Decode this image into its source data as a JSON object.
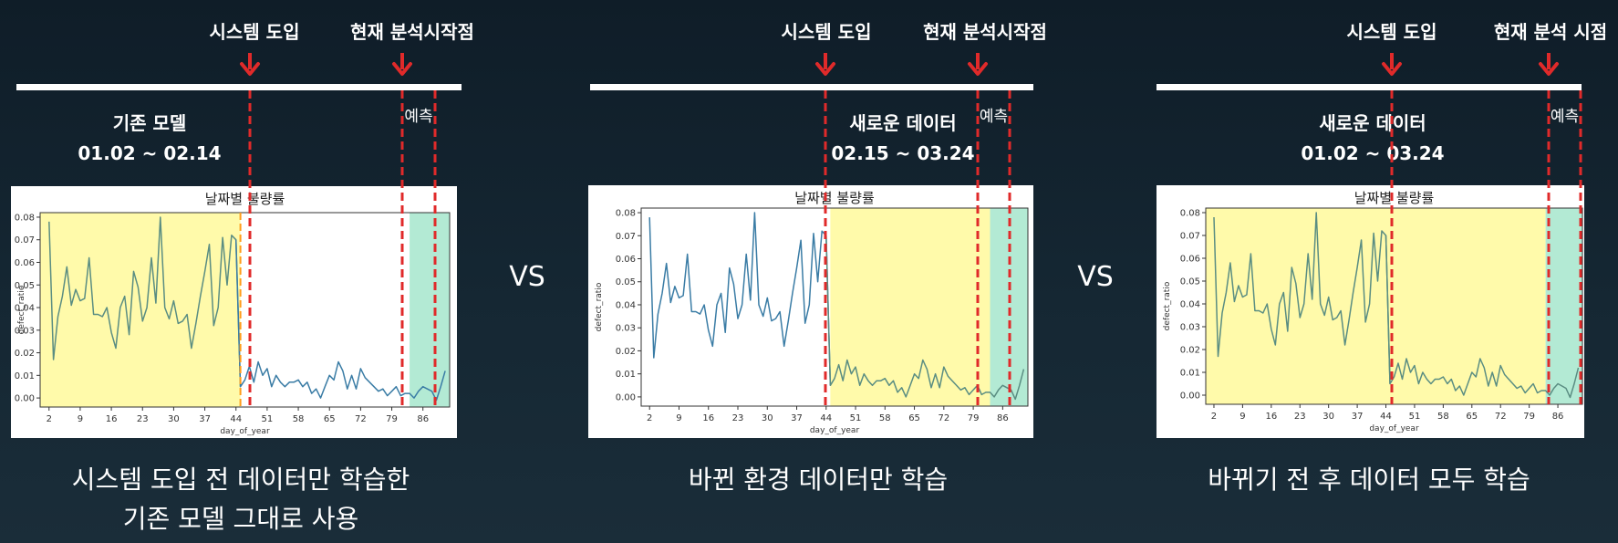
{
  "labels": {
    "intro": "시스템 도입",
    "now_start": "현재 분석시작점",
    "now_point": "현재 분석 시점",
    "predict": "예측",
    "vs": "VS",
    "plot_title": "날짜별 불량률",
    "xlabel": "day_of_year",
    "ylabel": "defect_ratio"
  },
  "panels": [
    {
      "model": "기존 모델",
      "range": "01.02 ~ 02.14",
      "caption_lines": [
        "시스템 도입 전 데이터만 학습한",
        "기존 모델 그대로 사용"
      ],
      "highlight": "before",
      "now_label": "now_start"
    },
    {
      "model": "새로운 데이터",
      "range": "02.15 ~ 03.24",
      "caption_lines": [
        "바뀐 환경 데이터만 학습"
      ],
      "highlight": "after",
      "now_label": "now_start"
    },
    {
      "model": "새로운 데이터",
      "range": "01.02 ~ 03.24",
      "caption_lines": [
        "바뀌기 전 후 데이터 모두 학습"
      ],
      "highlight": "all",
      "now_label": "now_point"
    }
  ],
  "colors": {
    "train_highlight": "#fffaaa",
    "predict_highlight": "#b3ead4",
    "line_before": "#5a8d82",
    "line_after": "#3a7ca5",
    "marker_red": "#e02a2a",
    "marker_orange": "#ff9c1a"
  },
  "chart_data": {
    "type": "line",
    "title": "날짜별 불량률",
    "xlabel": "day_of_year",
    "ylabel": "defect_ratio",
    "xlim": [
      0,
      92
    ],
    "ylim": [
      -0.004,
      0.082
    ],
    "xticks": [
      2,
      9,
      16,
      23,
      30,
      37,
      44,
      51,
      58,
      65,
      72,
      79,
      86
    ],
    "yticks": [
      0.0,
      0.01,
      0.02,
      0.03,
      0.04,
      0.05,
      0.06,
      0.07,
      0.08
    ],
    "ytick_labels": [
      "0.00",
      "0.01",
      "0.02",
      "0.03",
      "0.04",
      "0.05",
      "0.06",
      "0.07",
      "0.08"
    ],
    "intro_day": 45,
    "analysis_start_day": 83,
    "predict_end_day": 91,
    "x": [
      2,
      3,
      4,
      5,
      6,
      7,
      8,
      9,
      10,
      11,
      12,
      13,
      14,
      15,
      16,
      17,
      18,
      19,
      20,
      21,
      22,
      23,
      24,
      25,
      26,
      27,
      28,
      29,
      30,
      31,
      32,
      33,
      34,
      35,
      36,
      37,
      38,
      39,
      40,
      41,
      42,
      43,
      44,
      45,
      46,
      47,
      48,
      49,
      50,
      51,
      52,
      53,
      54,
      55,
      56,
      57,
      58,
      59,
      60,
      61,
      62,
      63,
      64,
      65,
      66,
      67,
      68,
      69,
      70,
      71,
      72,
      73,
      74,
      75,
      76,
      77,
      78,
      79,
      80,
      81,
      82,
      83,
      84,
      85,
      86,
      87,
      88,
      89,
      90,
      91
    ],
    "y": [
      0.078,
      0.017,
      0.036,
      0.045,
      0.058,
      0.041,
      0.048,
      0.043,
      0.044,
      0.062,
      0.037,
      0.037,
      0.036,
      0.04,
      0.029,
      0.022,
      0.04,
      0.045,
      0.028,
      0.056,
      0.049,
      0.034,
      0.04,
      0.062,
      0.042,
      0.08,
      0.04,
      0.035,
      0.043,
      0.033,
      0.034,
      0.037,
      0.022,
      0.033,
      0.045,
      0.056,
      0.068,
      0.032,
      0.04,
      0.071,
      0.05,
      0.072,
      0.07,
      0.005,
      0.008,
      0.014,
      0.007,
      0.016,
      0.01,
      0.013,
      0.005,
      0.01,
      0.007,
      0.005,
      0.007,
      0.007,
      0.008,
      0.005,
      0.007,
      0.002,
      0.004,
      0.0,
      0.005,
      0.01,
      0.008,
      0.016,
      0.012,
      0.004,
      0.01,
      0.004,
      0.013,
      0.009,
      0.007,
      0.005,
      0.003,
      0.004,
      0.001,
      0.003,
      0.005,
      0.001,
      0.002,
      0.002,
      0.0,
      0.003,
      0.005,
      0.004,
      0.003,
      -0.001,
      0.005,
      0.012,
      0.018
    ]
  }
}
